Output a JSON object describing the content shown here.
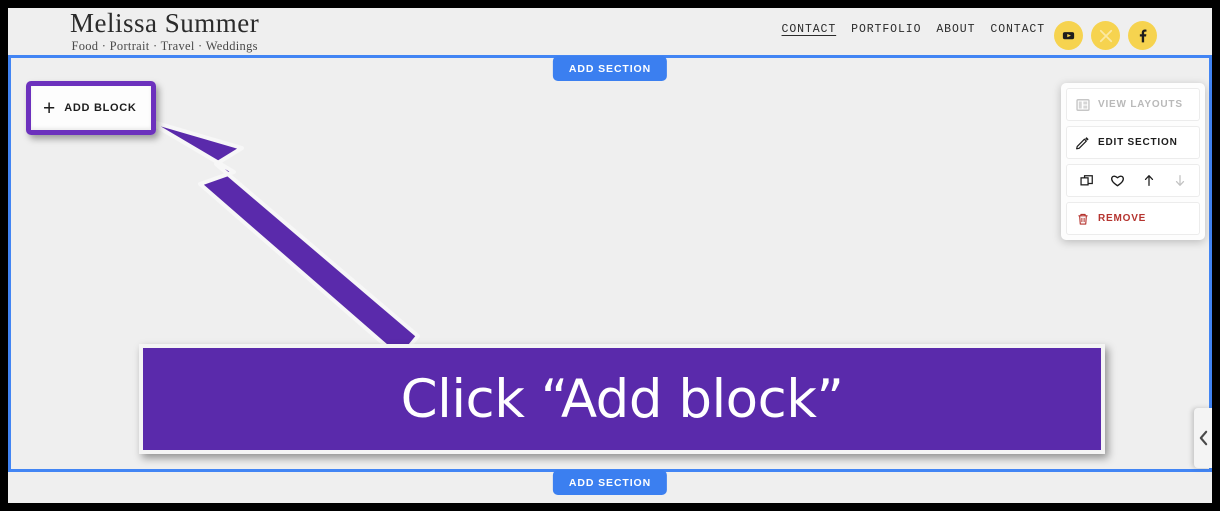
{
  "site": {
    "logo_title": "Melissa Summer",
    "logo_tagline": "Food · Portrait · Travel · Weddings",
    "nav": [
      {
        "label": "CONTACT",
        "active": true
      },
      {
        "label": "PORTFOLIO",
        "active": false
      },
      {
        "label": "ABOUT",
        "active": false
      },
      {
        "label": "CONTACT",
        "active": false
      }
    ],
    "socials": [
      {
        "name": "youtube-icon"
      },
      {
        "name": "x-icon"
      },
      {
        "name": "facebook-icon"
      }
    ],
    "social_color": "#f6d34f"
  },
  "editor": {
    "add_section_top": "ADD SECTION",
    "add_section_bottom": "ADD SECTION",
    "add_block_label": "ADD BLOCK",
    "add_block_plus": "+",
    "section_outline_color": "#4285f4",
    "highlight_color": "#6c31bd"
  },
  "tool_panel": {
    "view_layouts": "VIEW LAYOUTS",
    "edit_section": "EDIT SECTION",
    "remove": "REMOVE",
    "remove_color": "#b5342f",
    "icons": [
      {
        "name": "duplicate-icon",
        "disabled": false
      },
      {
        "name": "heart-icon",
        "disabled": false
      },
      {
        "name": "move-up-icon",
        "disabled": false
      },
      {
        "name": "move-down-icon",
        "disabled": true
      }
    ]
  },
  "callout": {
    "text": "Click “Add block”",
    "background": "#5a2aab"
  }
}
